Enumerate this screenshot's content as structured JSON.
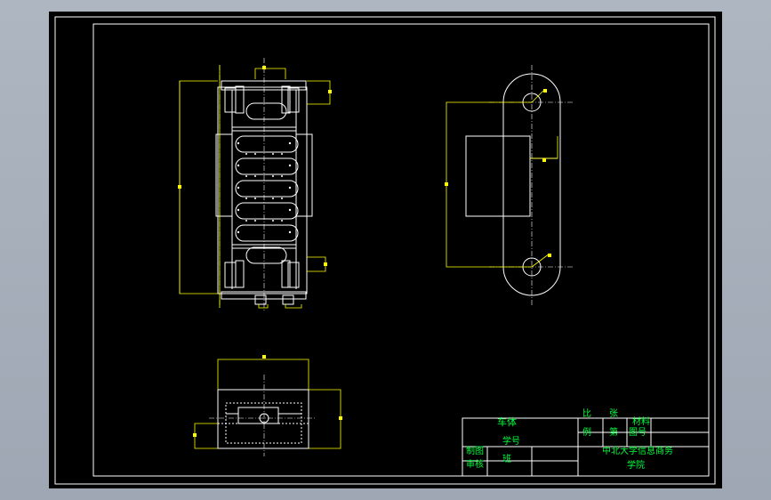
{
  "colors": {
    "background": "#000000",
    "frame": "#ffffff",
    "geometry": "#ffffff",
    "dimension": "#ffff00",
    "title_text": "#00ff3c",
    "desktop": "#aeb6c1"
  },
  "title_block": {
    "part_name": "车体",
    "material_label": "材料",
    "scale_label": "比",
    "scale_label_2": "例",
    "sheet_label": "张",
    "sheet_label_2": "第",
    "drawing_no": "图号",
    "drawn_label": "制图",
    "checked_label": "审核",
    "note_1": "学号",
    "note_2": "班",
    "school_line_1": "中北大学信息商务",
    "school_line_2": "学院"
  }
}
